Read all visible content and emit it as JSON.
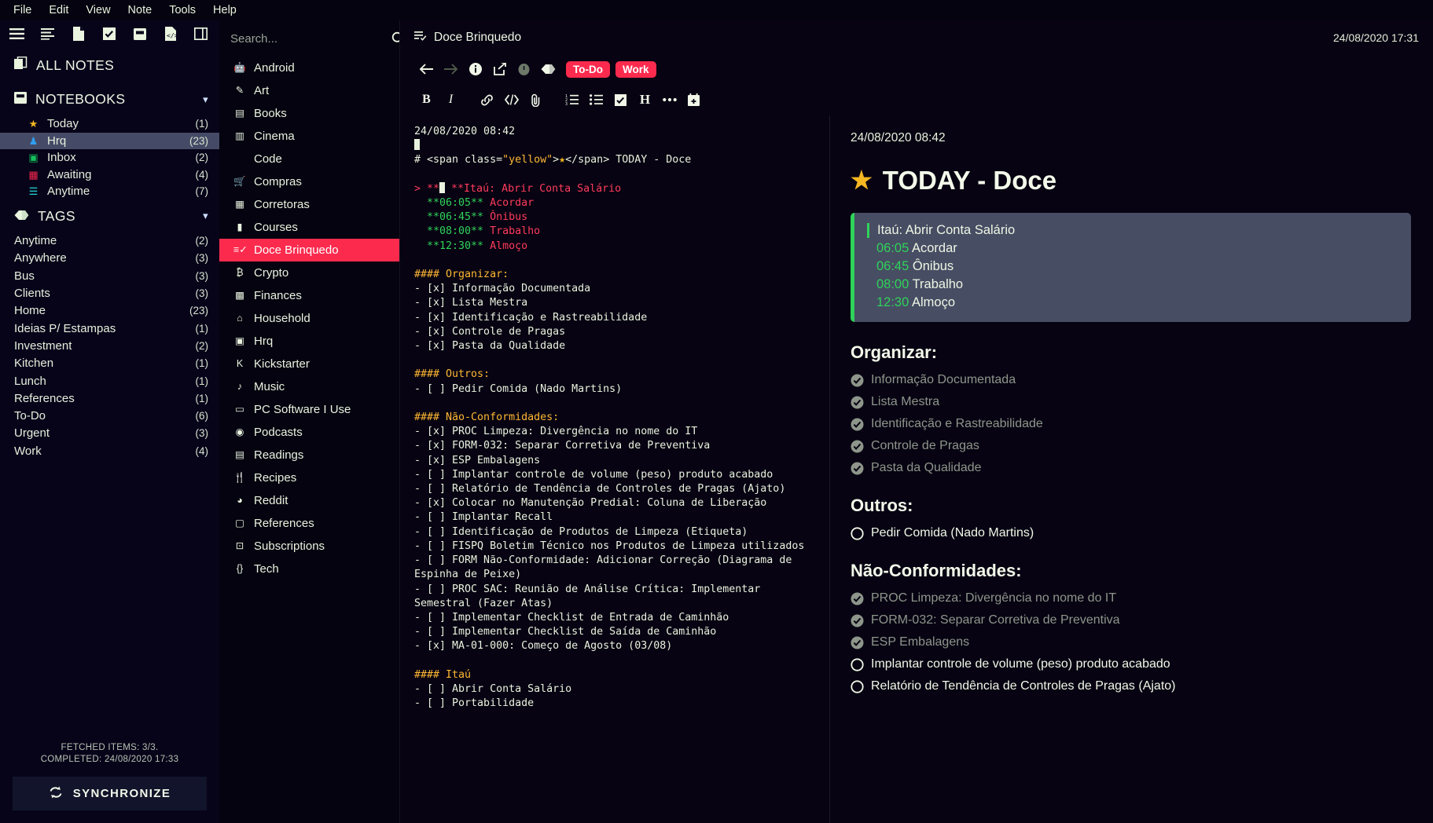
{
  "menubar": [
    "File",
    "Edit",
    "View",
    "Note",
    "Tools",
    "Help"
  ],
  "sidebar": {
    "toolbar_icons": [
      "hamburger-icon",
      "list-icon",
      "new-note-icon",
      "new-todo-icon",
      "new-notebook-icon",
      "code-note-icon",
      "layout-icon"
    ],
    "all_notes_label": "ALL NOTES",
    "notebooks_label": "NOTEBOOKS",
    "tags_label": "TAGS",
    "notebooks": [
      {
        "icon": "★",
        "label": "Today",
        "count": "(1)",
        "color": "#f5b721"
      },
      {
        "icon": "♟",
        "label": "Hrq",
        "count": "(23)",
        "color": "#2f9ff2"
      },
      {
        "icon": "▣",
        "label": "Inbox",
        "count": "(2)",
        "color": "#15c05b"
      },
      {
        "icon": "▦",
        "label": "Awaiting",
        "count": "(4)",
        "color": "#f6254c"
      },
      {
        "icon": "☰",
        "label": "Anytime",
        "count": "(7)",
        "color": "#1fd6d6"
      }
    ],
    "tags": [
      {
        "label": "Anytime",
        "count": "(2)"
      },
      {
        "label": "Anywhere",
        "count": "(3)"
      },
      {
        "label": "Bus",
        "count": "(3)"
      },
      {
        "label": "Clients",
        "count": "(3)"
      },
      {
        "label": "Home",
        "count": "(23)"
      },
      {
        "label": "Ideias P/ Estampas",
        "count": "(1)"
      },
      {
        "label": "Investment",
        "count": "(2)"
      },
      {
        "label": "Kitchen",
        "count": "(1)"
      },
      {
        "label": "Lunch",
        "count": "(1)"
      },
      {
        "label": "References",
        "count": "(1)"
      },
      {
        "label": "To-Do",
        "count": "(6)"
      },
      {
        "label": "Urgent",
        "count": "(3)"
      },
      {
        "label": "Work",
        "count": "(4)"
      }
    ],
    "footer": {
      "fetched": "FETCHED ITEMS: 3/3.",
      "completed": "COMPLETED: 24/08/2020 17:33",
      "sync_label": "SYNCHRONIZE"
    }
  },
  "search": {
    "placeholder": "Search...",
    "value": ""
  },
  "notebook_list": [
    {
      "icon": "🤖",
      "label": "Android"
    },
    {
      "icon": "✎",
      "label": "Art"
    },
    {
      "icon": "▤",
      "label": "Books"
    },
    {
      "icon": "▥",
      "label": "Cinema"
    },
    {
      "icon": "</>",
      "label": "Code"
    },
    {
      "icon": "🛒",
      "label": "Compras"
    },
    {
      "icon": "▦",
      "label": "Corretoras"
    },
    {
      "icon": "▮",
      "label": "Courses"
    },
    {
      "icon": "≡✓",
      "label": "Doce Brinquedo",
      "active": true
    },
    {
      "icon": "₿",
      "label": "Crypto"
    },
    {
      "icon": "▩",
      "label": "Finances"
    },
    {
      "icon": "⌂",
      "label": "Household"
    },
    {
      "icon": "▣",
      "label": "Hrq"
    },
    {
      "icon": "K",
      "label": "Kickstarter"
    },
    {
      "icon": "♪",
      "label": "Music"
    },
    {
      "icon": "▭",
      "label": "PC Software I Use"
    },
    {
      "icon": "◉",
      "label": "Podcasts"
    },
    {
      "icon": "▤",
      "label": "Readings"
    },
    {
      "icon": "🍴",
      "label": "Recipes"
    },
    {
      "icon": "◕",
      "label": "Reddit"
    },
    {
      "icon": "▢",
      "label": "References"
    },
    {
      "icon": "⊡",
      "label": "Subscriptions"
    },
    {
      "icon": "{}",
      "label": "Tech"
    }
  ],
  "editor": {
    "title": "Doce Brinquedo",
    "title_icon": "checklist-icon",
    "datetime": "24/08/2020 17:31",
    "nav_icons": [
      "back-arrow-icon",
      "forward-arrow-icon",
      "info-icon",
      "share-icon",
      "history-icon",
      "tag-icon"
    ],
    "note_tags": [
      "To-Do",
      "Work"
    ],
    "format_icons": [
      "bold-icon",
      "italic-icon",
      "link-icon",
      "code-icon",
      "attachment-icon",
      "ordered-list-icon",
      "unordered-list-icon",
      "checkbox-icon",
      "heading-icon",
      "more-icon",
      "calendar-icon"
    ],
    "accent_color": "#fc2b4e"
  },
  "source": {
    "date_line": "24/08/2020 08:42",
    "heading_line": "# <span class=\"yellow\">★</span> TODAY - Doce",
    "quote": {
      "prefix": "> ** **",
      "title": "Itaú: Abrir Conta Salário",
      "rows": [
        {
          "time": "**06:05**",
          "label": "Acordar"
        },
        {
          "time": "**06:45**",
          "label": "Ônibus"
        },
        {
          "time": "**08:00**",
          "label": "Trabalho"
        },
        {
          "time": "**12:30**",
          "label": "Almoço"
        }
      ]
    },
    "sections": [
      {
        "heading": "#### Organizar:",
        "items": [
          "- [x] Informação Documentada",
          "- [x] Lista Mestra",
          "- [x] Identificação e Rastreabilidade",
          "- [x] Controle de Pragas",
          "- [x] Pasta da Qualidade"
        ]
      },
      {
        "heading": "#### Outros:",
        "items": [
          "- [ ] Pedir Comida (Nado Martins)"
        ]
      },
      {
        "heading": "#### Não-Conformidades:",
        "items": [
          "- [x] PROC Limpeza: Divergência no nome do IT",
          "- [x] FORM-032: Separar Corretiva de Preventiva",
          "- [x] ESP Embalagens",
          "- [ ] Implantar controle de volume (peso) produto acabado",
          "- [ ] Relatório de Tendência de Controles de Pragas (Ajato)",
          "- [x] Colocar no Manutenção Predial: Coluna de Liberação",
          "- [ ] Implantar Recall",
          "- [ ] Identificação de Produtos de Limpeza (Etiqueta)",
          "- [ ] FISPQ Boletim Técnico nos Produtos de Limpeza utilizados",
          "- [ ] FORM Não-Conformidade: Adicionar Correção (Diagrama de Espinha de Peixe)",
          "- [ ] PROC SAC: Reunião de Análise Crítica: Implementar Semestral (Fazer Atas)",
          "- [ ] Implementar Checklist de Entrada de Caminhão",
          "- [ ] Implementar Checklist de Saída de Caminhão",
          "- [x] MA-01-000: Começo de Agosto (03/08)"
        ]
      },
      {
        "heading": "#### Itaú",
        "items": [
          "- [ ] Abrir Conta Salário",
          "- [ ] Portabilidade"
        ]
      }
    ]
  },
  "preview": {
    "date": "24/08/2020 08:42",
    "title": "TODAY - Doce",
    "title_star": "★",
    "quote": {
      "title": "Itaú: Abrir Conta Salário",
      "rows": [
        {
          "time": "06:05",
          "label": "Acordar"
        },
        {
          "time": "06:45",
          "label": "Ônibus"
        },
        {
          "time": "08:00",
          "label": "Trabalho"
        },
        {
          "time": "12:30",
          "label": "Almoço"
        }
      ]
    },
    "sections": [
      {
        "heading": "Organizar:",
        "items": [
          {
            "text": "Informação Documentada",
            "done": true
          },
          {
            "text": "Lista Mestra",
            "done": true
          },
          {
            "text": "Identificação e Rastreabilidade",
            "done": true
          },
          {
            "text": "Controle de Pragas",
            "done": true
          },
          {
            "text": "Pasta da Qualidade",
            "done": true
          }
        ]
      },
      {
        "heading": "Outros:",
        "items": [
          {
            "text": "Pedir Comida (Nado Martins)",
            "done": false
          }
        ]
      },
      {
        "heading": "Não-Conformidades:",
        "items": [
          {
            "text": "PROC Limpeza: Divergência no nome do IT",
            "done": true
          },
          {
            "text": "FORM-032: Separar Corretiva de Preventiva",
            "done": true
          },
          {
            "text": "ESP Embalagens",
            "done": true
          },
          {
            "text": "Implantar controle de volume (peso) produto acabado",
            "done": false
          },
          {
            "text": "Relatório de Tendência de Controles de Pragas (Ajato)",
            "done": false
          }
        ]
      }
    ]
  }
}
